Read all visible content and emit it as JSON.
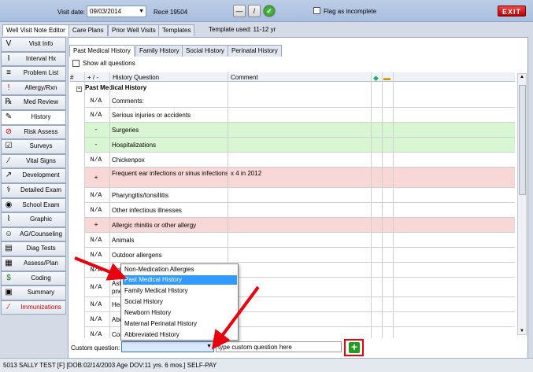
{
  "header": {
    "visit_date_label": "Visit date:",
    "visit_date_value": "09/03/2014",
    "record": "Rec# 19504",
    "flag_label": "Flag as incomplete",
    "exit_label": "EXIT"
  },
  "main_tabs": [
    "Well Visit Note Editor",
    "Care Plans",
    "Prior Well Visits",
    "Templates"
  ],
  "template_used": "Template used:  11-12 yr",
  "sidebar": {
    "items": [
      {
        "label": "Visit Info",
        "icon": "V"
      },
      {
        "label": "Interval Hx",
        "icon": "I"
      },
      {
        "label": "Problem List",
        "icon": "≡"
      },
      {
        "label": "Allergy/Rxn",
        "icon": "!"
      },
      {
        "label": "Med Review",
        "icon": "℞"
      },
      {
        "label": "History",
        "icon": "✎"
      },
      {
        "label": "Risk Assess",
        "icon": "⊘"
      },
      {
        "label": "Surveys",
        "icon": "☑"
      },
      {
        "label": "Vital Signs",
        "icon": "⁄"
      },
      {
        "label": "Development",
        "icon": "↗"
      },
      {
        "label": "Detailed Exam",
        "icon": "⚕"
      },
      {
        "label": "School Exam",
        "icon": "◉"
      },
      {
        "label": "Graphic",
        "icon": "⌇"
      },
      {
        "label": "AG/Counseling",
        "icon": "☺"
      },
      {
        "label": "Diag Tests",
        "icon": "▤"
      },
      {
        "label": "Assess/Plan",
        "icon": "▦"
      },
      {
        "label": "Coding",
        "icon": "$"
      },
      {
        "label": "Summary",
        "icon": "▣"
      },
      {
        "label": "Immunizations",
        "icon": "⁄"
      }
    ]
  },
  "sub_tabs": [
    "Past Medical History",
    "Family History",
    "Social History",
    "Perinatal History"
  ],
  "show_all_label": "Show all questions",
  "grid_headers": {
    "hash": "#",
    "plusminus": "+ / -",
    "question": "History Question",
    "comment": "Comment"
  },
  "section_title": "Past Medical History",
  "rows": [
    {
      "sym": "N/A",
      "q": "Comments:",
      "c": "",
      "color": "white"
    },
    {
      "sym": "N/A",
      "q": "Serious injuries or accidents",
      "c": "",
      "color": "white"
    },
    {
      "sym": "-",
      "q": "Surgeries",
      "c": "",
      "color": "green"
    },
    {
      "sym": "-",
      "q": "Hospitalizations",
      "c": "",
      "color": "green"
    },
    {
      "sym": "N/A",
      "q": "Chickenpox",
      "c": "",
      "color": "white"
    },
    {
      "sym": "+",
      "q": "Frequent ear infections or sinus infections",
      "c": "x 4 in 2012",
      "color": "red"
    },
    {
      "sym": "N/A",
      "q": "Pharyngitis/tonsillitis",
      "c": "",
      "color": "white"
    },
    {
      "sym": "N/A",
      "q": "Other infectious illnesses",
      "c": "",
      "color": "white"
    },
    {
      "sym": "+",
      "q": "Allergic rhinitis or other allergy",
      "c": "",
      "color": "red"
    },
    {
      "sym": "N/A",
      "q": "Animals",
      "c": "",
      "color": "white"
    },
    {
      "sym": "N/A",
      "q": "Outdoor allergens",
      "c": "",
      "color": "white"
    },
    {
      "sym": "N/A",
      "q": "Indo",
      "c": "",
      "color": "white"
    },
    {
      "sym": "N/A",
      "q": "Ast pne",
      "c": "",
      "color": "white"
    },
    {
      "sym": "N/A",
      "q": "Hea",
      "c": "",
      "color": "white"
    },
    {
      "sym": "N/A",
      "q": "Abd",
      "c": "",
      "color": "white"
    },
    {
      "sym": "N/A",
      "q": "Con",
      "c": "",
      "color": "white"
    }
  ],
  "custom": {
    "label": "Custom question:",
    "input_placeholder": "type custom question here"
  },
  "dropdown_options": [
    {
      "label": "Non-Medication Allergies",
      "selected": false
    },
    {
      "label": "Past Medical History",
      "selected": true
    },
    {
      "label": "Family Medical History",
      "selected": false
    },
    {
      "label": "Social History",
      "selected": false
    },
    {
      "label": "Newborn History",
      "selected": false
    },
    {
      "label": "Maternal Perinatal History",
      "selected": false
    },
    {
      "label": "Abbreviated History",
      "selected": false
    }
  ],
  "status_bar": "5013 SALLY TEST [F] [DOB:02/14/2003  Age DOV:11 yrs. 6 mos.] SELF-PAY",
  "colors": {
    "accent": "#3399ff",
    "annotation_red": "#e8000f",
    "green_row": "#d9f6d2",
    "red_row": "#f8d7d7"
  }
}
